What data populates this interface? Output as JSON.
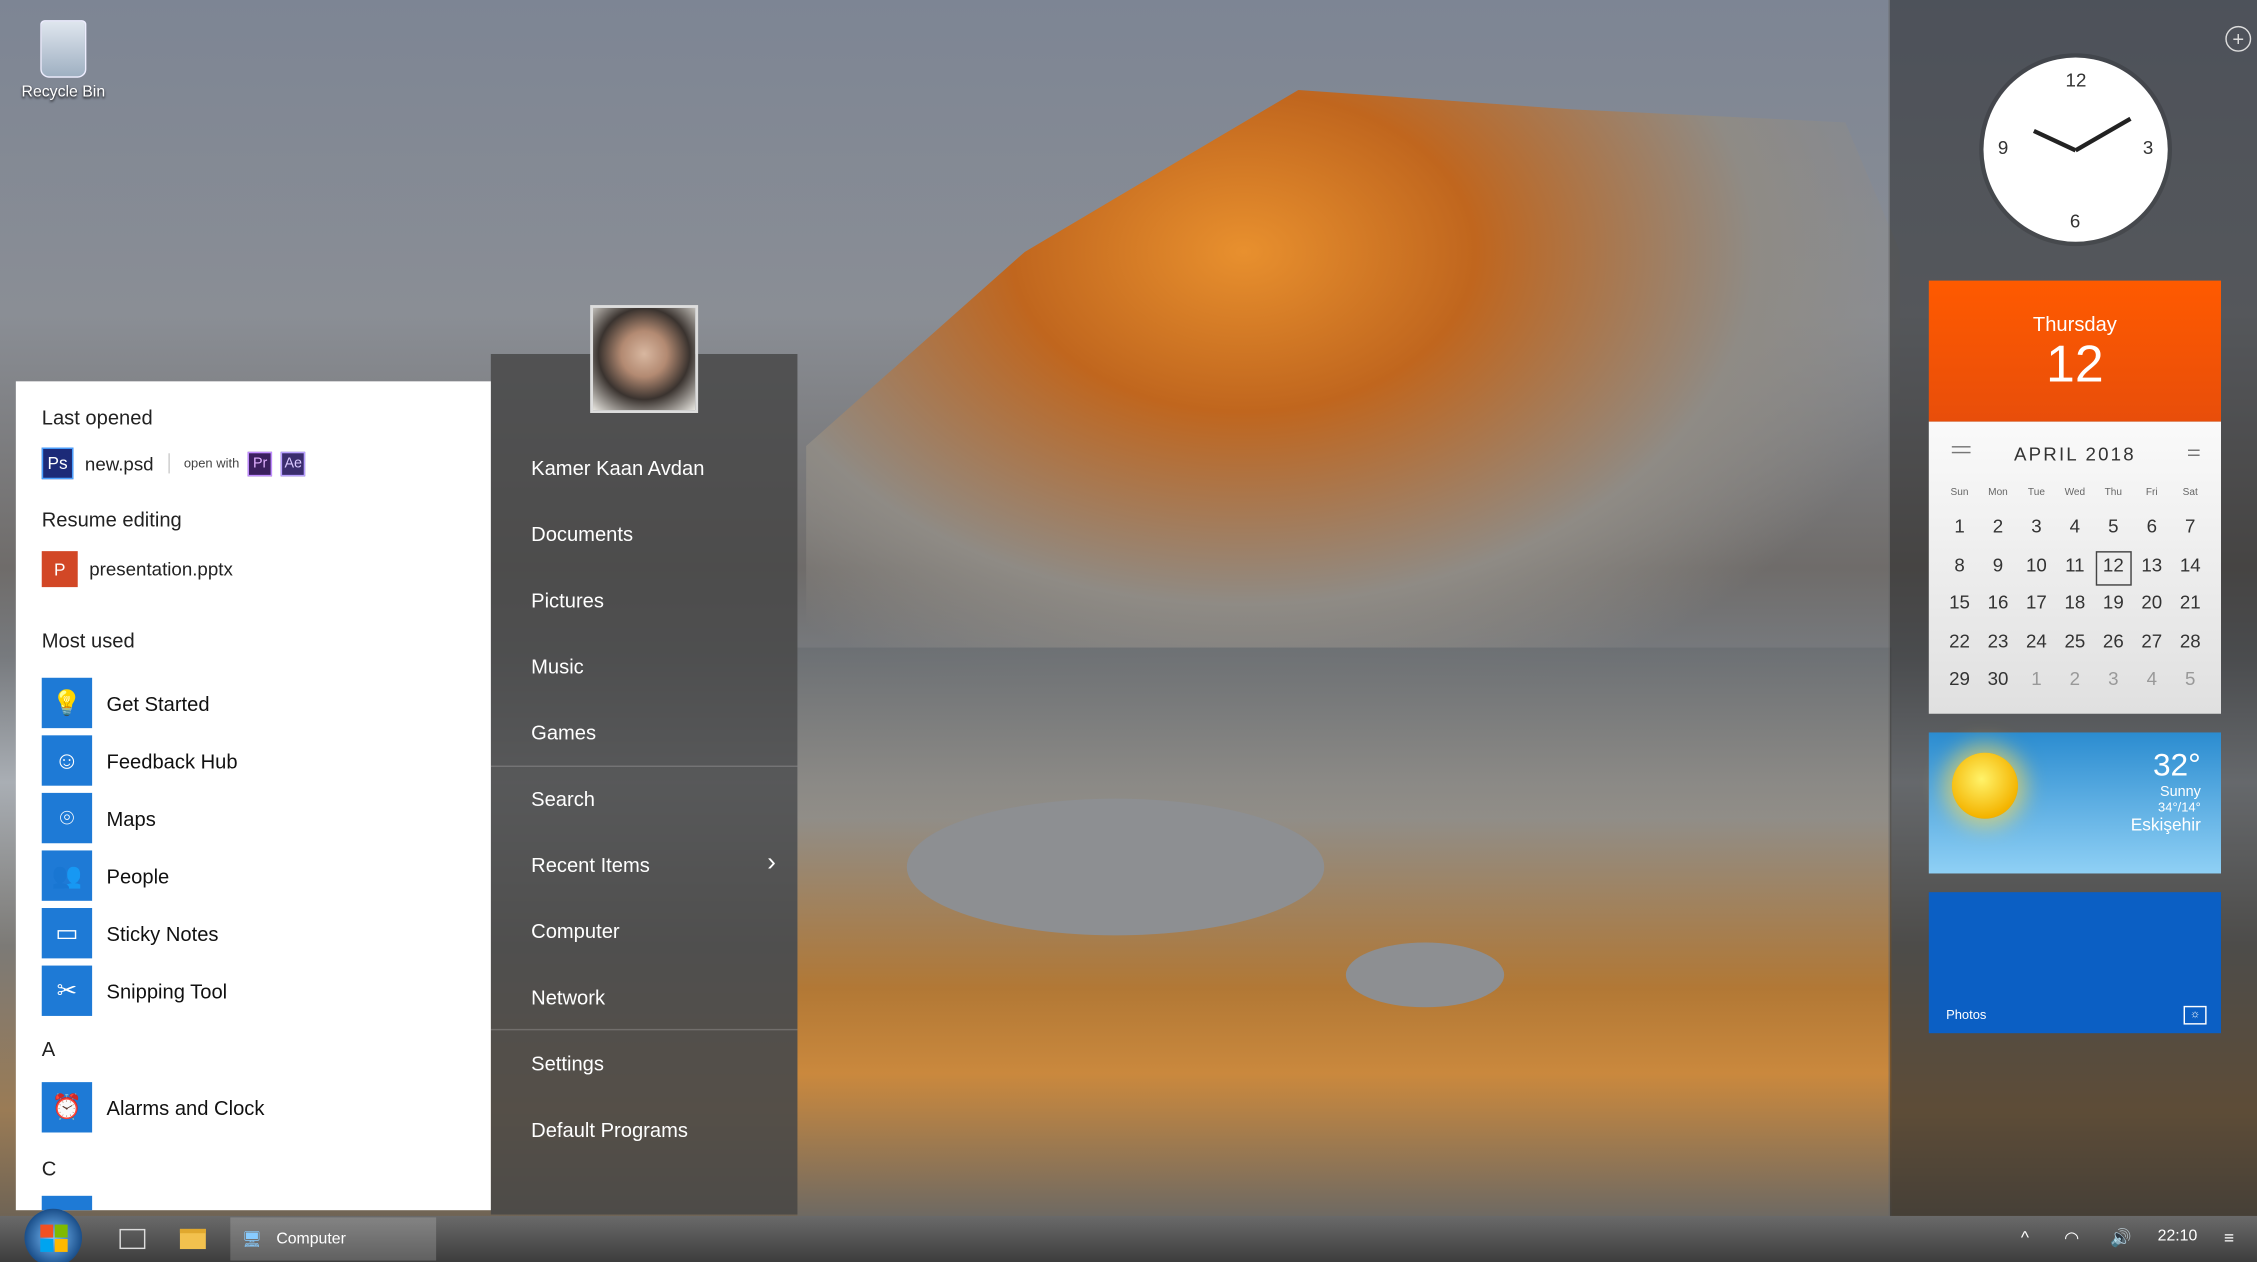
{
  "desktop": {
    "icons": [
      {
        "label": "Recycle Bin",
        "icon": "recycle-bin-icon"
      }
    ]
  },
  "start_menu": {
    "last_opened": {
      "heading": "Last opened",
      "file": "new.psd",
      "app_badge": "Ps",
      "open_with_label": "open with",
      "open_with": [
        "Pr",
        "Ae"
      ]
    },
    "resume_editing": {
      "heading": "Resume editing",
      "file": "presentation.pptx",
      "app_badge": "P"
    },
    "most_used": {
      "heading": "Most used",
      "items": [
        {
          "label": "Get Started",
          "icon": "lightbulb-icon"
        },
        {
          "label": "Feedback Hub",
          "icon": "feedback-icon"
        },
        {
          "label": "Maps",
          "icon": "maps-icon"
        },
        {
          "label": "People",
          "icon": "people-icon"
        },
        {
          "label": "Sticky Notes",
          "icon": "sticky-note-icon"
        },
        {
          "label": "Snipping Tool",
          "icon": "scissors-icon"
        }
      ]
    },
    "letter_a": "A",
    "a_items": [
      {
        "label": "Alarms and Clock",
        "icon": "alarm-clock-icon"
      }
    ],
    "letter_c": "C",
    "right": {
      "user": "Kamer Kaan Avdan",
      "items": [
        "Documents",
        "Pictures",
        "Music",
        "Games",
        "Search",
        "Recent Items",
        "Computer",
        "Network",
        "Settings",
        "Default Programs"
      ]
    }
  },
  "sidebar": {
    "clock": {
      "numbers": [
        "12",
        "3",
        "6",
        "9"
      ],
      "time": "22:10"
    },
    "calendar": {
      "weekday": "Thursday",
      "day": "12",
      "month_title": "APRIL 2018",
      "day_headers": [
        "Sun",
        "Mon",
        "Tue",
        "Wed",
        "Thu",
        "Fri",
        "Sat"
      ],
      "days": [
        "1",
        "2",
        "3",
        "4",
        "5",
        "6",
        "7",
        "8",
        "9",
        "10",
        "11",
        "12",
        "13",
        "14",
        "15",
        "16",
        "17",
        "18",
        "19",
        "20",
        "21",
        "22",
        "23",
        "24",
        "25",
        "26",
        "27",
        "28",
        "29",
        "30"
      ],
      "next_days": [
        "1",
        "2",
        "3",
        "4",
        "5"
      ],
      "today": "12"
    },
    "weather": {
      "temp": "32°",
      "condition": "Sunny",
      "range": "34°/14°",
      "city": "Eskişehir"
    },
    "photos": {
      "label": "Photos"
    }
  },
  "taskbar": {
    "window": "Computer",
    "time": "22:10"
  },
  "colors": {
    "calendar_accent": "#ff5a00",
    "photos_tile": "#0b5fc4",
    "app_tile": "#1e7ad6"
  }
}
